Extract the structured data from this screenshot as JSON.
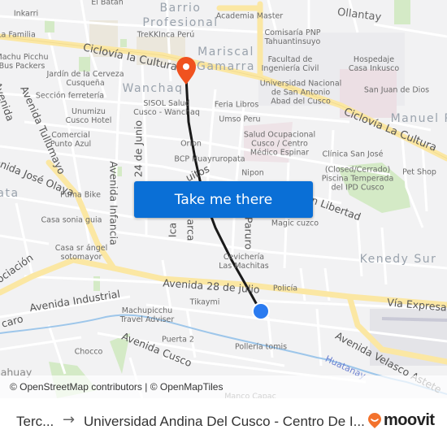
{
  "map": {
    "districts": [
      {
        "text": "Barrio\nProfesional",
        "name": "district-barrio-profesional"
      },
      {
        "text": "Mariscal\nGamarra",
        "name": "district-mariscal-gamarra"
      },
      {
        "text": "Wanchaq",
        "name": "district-wanchaq"
      },
      {
        "text": "Ollantay",
        "name": "district-ollantay"
      },
      {
        "text": "Manuel Pr",
        "name": "district-manuel-prado"
      },
      {
        "text": "Kenedy Sur",
        "name": "district-kenedy-sur"
      },
      {
        "text": "ata",
        "name": "district-partial-ata"
      }
    ],
    "roads": [
      "Ciclovía la Cultura",
      "Ciclovía La Cultura",
      "Avenida Tullumayo",
      "Avenida José Olaya",
      "Avenida Infancia",
      "24 de Junio",
      "Avenida 28 de julio",
      "Avenida Industrial",
      "Avenida Cusco",
      "Vía Expresa",
      "Avenida Velasco Astete",
      "ón Libertad",
      "Paruro",
      "Ica",
      "arca",
      "uitos",
      "ociación",
      "caro",
      "Avenida",
      "ahuay"
    ],
    "river": "Huatanay",
    "pois": [
      "El Batán",
      "Inkarri",
      "La Familia",
      "Machu Picchu\nBus Packers",
      "Jardín de la Cerveza\nCusqueña",
      "Sección ferretería",
      "Unumizu\nCusco Hotel",
      "Comercial\nPunto Azul",
      "Puma Bike",
      "Casa sonia guia",
      "Casa sr ángel\nsotomayor",
      "TreKKInca Perú",
      "Academia Master",
      "Comisaría PNP\nTahuantinsuyo",
      "Facultad de\nIngeniería Civil",
      "Universidad Nacional\nde San Antonio\nAbad del Cusco",
      "Hospedaje\nCasa Inkusco",
      "San Juan de Dios",
      "SISOL Salud\nCusco - Wanchaq",
      "Feria Libros",
      "Umso Peru",
      "Orion",
      "BCP Huayruropata",
      "Nipon",
      "Salud Ocupacional\nCusco / Centro\nMédico Espinar",
      "Clínica San José",
      "(Closed/Cerrado)\nPiscina Temperada\ndel IPD Cusco",
      "Pet Shop",
      "Magic cuzco",
      "Cevichería\nLas Machitas",
      "Policía",
      "Tikaymi",
      "Machupicchu\nTravel Adviser",
      "Puerta 2",
      "Chocco",
      "Pollería tomis",
      "Manco Capac"
    ],
    "colors": {
      "background": "#f2f2f3",
      "major_road": "#fbe7a3",
      "route_line": "#1a1a1a",
      "destination_pin": "#f0521f",
      "origin_dot": "#2b7bf0",
      "park": "#cfe8c0",
      "river": "#9dc6ea"
    }
  },
  "cta": {
    "label": "Take me there",
    "color": "#0a6fd6"
  },
  "attribution": "© OpenStreetMap contributors | © OpenMapTiles",
  "footer": {
    "origin": "Terc...",
    "arrow": "→",
    "destination": "Universidad Andina Del Cusco - Centro De I...",
    "brand": "moovit",
    "brand_color": "#f3722c"
  }
}
